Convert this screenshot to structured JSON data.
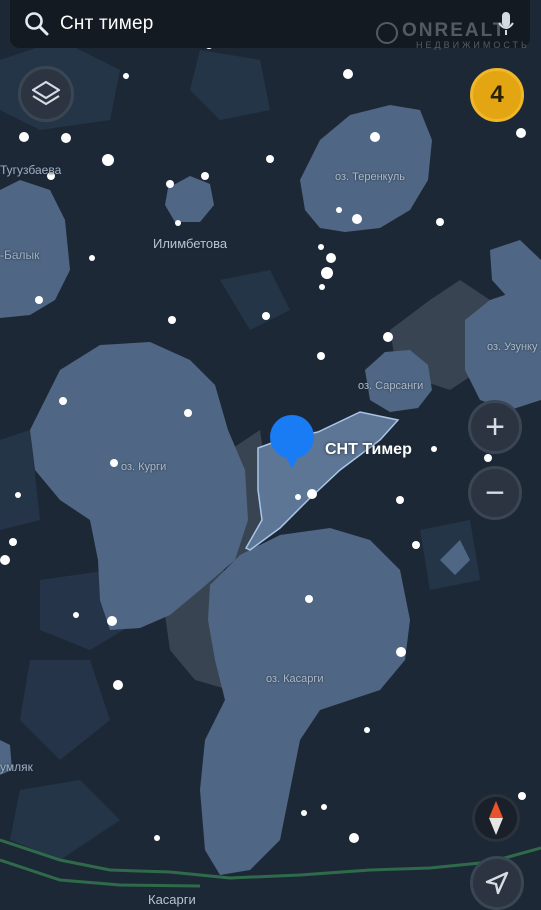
{
  "search": {
    "query": "Снт тимер"
  },
  "watermark": {
    "title": "ONREALT",
    "subtitle": "НЕДВИЖИМОСТЬ"
  },
  "cluster_badge": {
    "count": "4"
  },
  "map": {
    "selected_place": "СНТ Тимер",
    "place_labels": [
      {
        "key": "tuguzbaeva",
        "text": "Тугузбаева"
      },
      {
        "key": "balyk",
        "text": "-Балык"
      },
      {
        "key": "ilimbetova",
        "text": "Илимбетова"
      },
      {
        "key": "terenkul",
        "text": "оз. Теренкуль"
      },
      {
        "key": "uzunkul",
        "text": "оз. Узунку"
      },
      {
        "key": "sarsangi",
        "text": "оз. Сарсанги"
      },
      {
        "key": "kurgi",
        "text": "оз. Курги"
      },
      {
        "key": "kasargi_lake",
        "text": "оз. Касарги"
      },
      {
        "key": "umlyak",
        "text": "умляк"
      },
      {
        "key": "kasargi_town",
        "text": "Касарги"
      }
    ]
  },
  "controls": {
    "zoom_in": "+",
    "zoom_out": "−"
  },
  "colors": {
    "background": "#1d2836",
    "lake": "#4f6784",
    "area": "#3a4656",
    "badge": "#e3a612",
    "pin": "#1a7cf5",
    "road": "#2f6b4a"
  },
  "icons": [
    "search-icon",
    "microphone-icon",
    "layers-icon",
    "compass-icon",
    "location-arrow-icon",
    "map-pin-icon"
  ]
}
